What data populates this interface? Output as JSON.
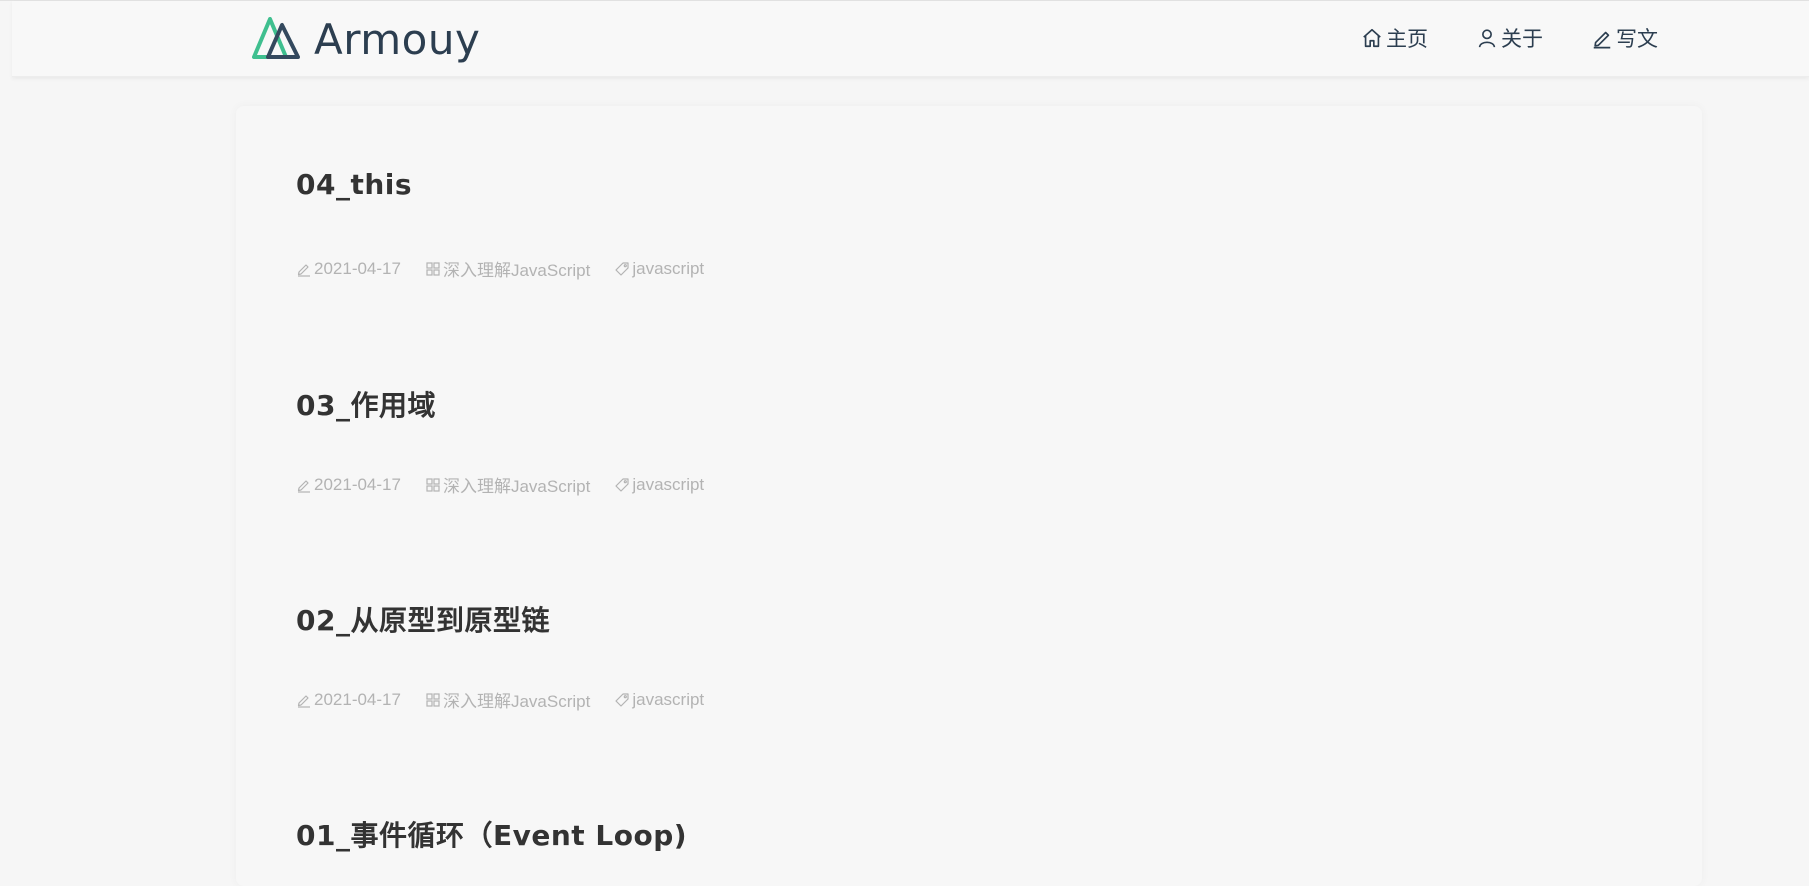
{
  "brand": {
    "name": "Armouy",
    "logo_icon": "vue-style-logo-icon"
  },
  "nav": {
    "items": [
      {
        "label": "主页",
        "icon": "home-icon"
      },
      {
        "label": "关于",
        "icon": "user-icon"
      },
      {
        "label": "写文",
        "icon": "pencil-icon"
      }
    ]
  },
  "posts": [
    {
      "title": "04_this",
      "date": "2021-04-17",
      "category": "深入理解JavaScript",
      "tag": "javascript"
    },
    {
      "title": "03_作用域",
      "date": "2021-04-17",
      "category": "深入理解JavaScript",
      "tag": "javascript"
    },
    {
      "title": "02_从原型到原型链",
      "date": "2021-04-17",
      "category": "深入理解JavaScript",
      "tag": "javascript"
    },
    {
      "title": "01_事件循环（Event Loop)"
    }
  ],
  "colors": {
    "logo_green": "#3fbf8f",
    "logo_dark": "#34495e",
    "nav_text": "#2c3e50",
    "title_text": "#333333",
    "meta_text": "#b3b3b3"
  }
}
